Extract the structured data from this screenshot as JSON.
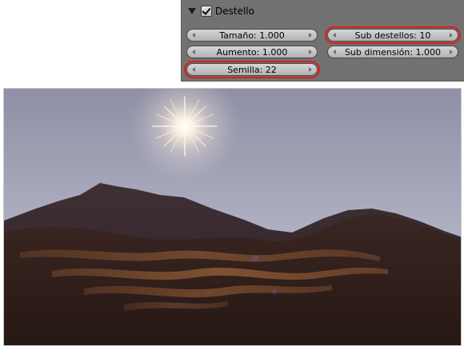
{
  "panel": {
    "title": "Destello",
    "enabled": true,
    "fields": {
      "tamano": "Tamaño: 1.000",
      "sub_destellos": "Sub destellos: 10",
      "aumento": "Aumento: 1.000",
      "sub_dimension": "Sub dimensión: 1.000",
      "semilla": "Semilla: 22"
    },
    "highlight_color": "#e01b1b"
  },
  "render": {
    "description_colors": {
      "sky_top": "#8f8fa5",
      "sky_horizon": "#b9bccb",
      "sun": "#ffffff",
      "dune_shadow": "#2a1c1c",
      "dune_light": "#a2663c"
    }
  }
}
